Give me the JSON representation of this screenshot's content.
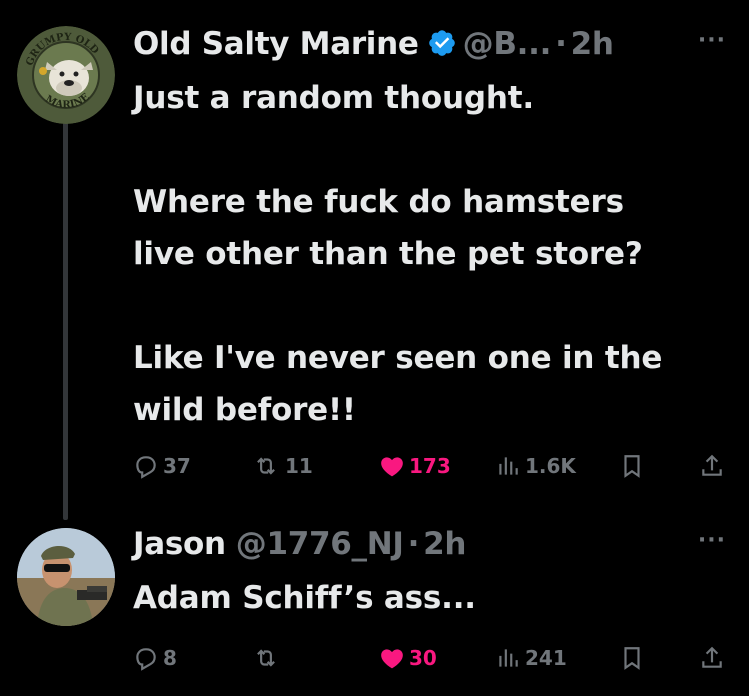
{
  "tweets": [
    {
      "author": {
        "name": "Old Salty Marine",
        "handle": "@B...",
        "avatar_label": "GRUMPY OLD MARINE"
      },
      "time": "2h",
      "text": "Just a random thought.\n\nWhere the fuck do hamsters\nlive other than the pet store?\n\nLike I've never seen one in the\nwild before!!",
      "stats": {
        "replies": "37",
        "reposts": "11",
        "likes": "173",
        "views": "1.6K"
      },
      "liked": true,
      "verified": true
    },
    {
      "author": {
        "name": "Jason",
        "handle": "@1776_NJ"
      },
      "time": "2h",
      "text": "Adam Schiff’s ass...",
      "stats": {
        "replies": "8",
        "reposts": "",
        "likes": "30",
        "views": "241"
      },
      "liked": true,
      "verified": false
    }
  ],
  "colors": {
    "background": "#000000",
    "text": "#e7e9ea",
    "muted": "#71767b",
    "like": "#f91880",
    "verified": "#1d9bf0"
  },
  "icons": [
    "reply-icon",
    "repost-icon",
    "like-icon",
    "views-icon",
    "bookmark-icon",
    "share-icon",
    "more-icon",
    "verified-badge-icon"
  ]
}
